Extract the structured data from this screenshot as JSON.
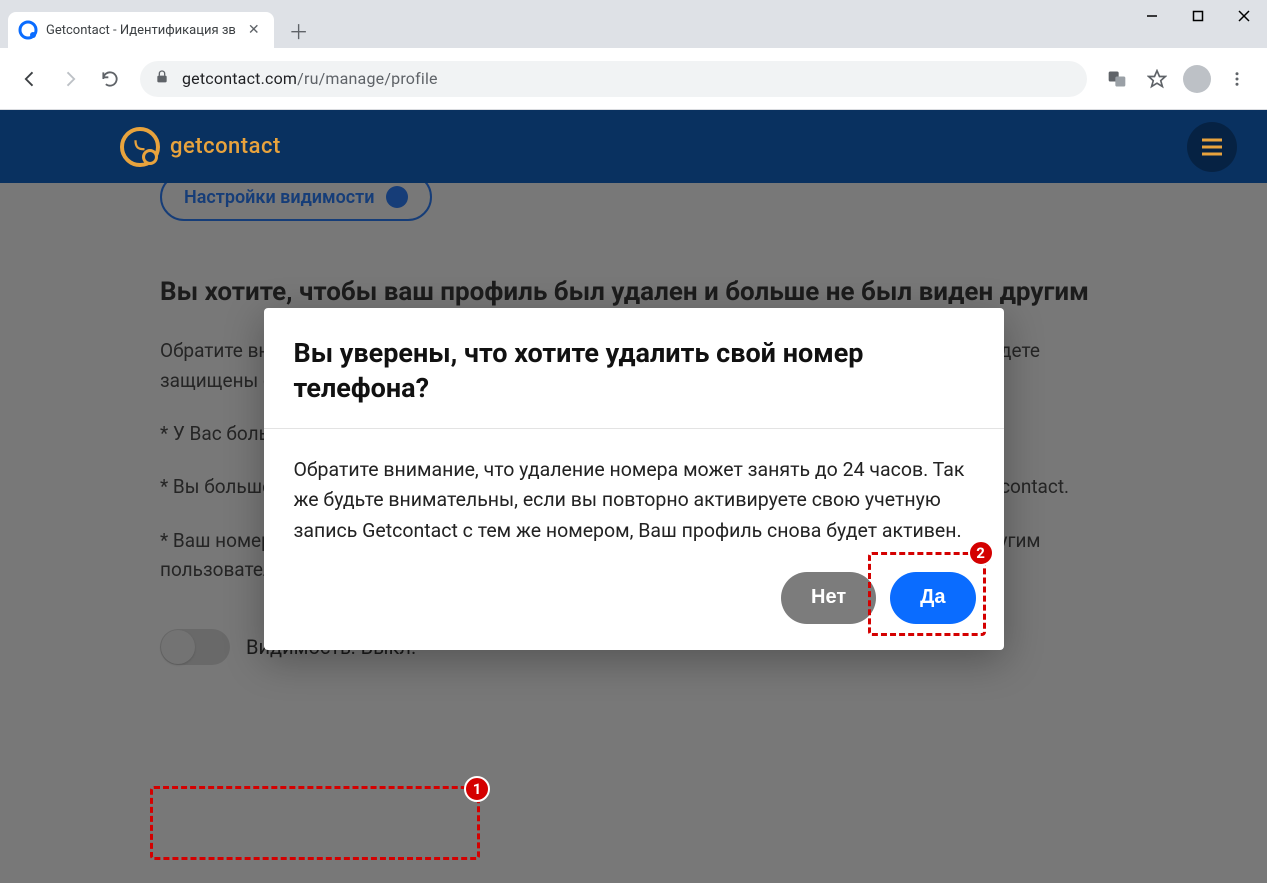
{
  "browser": {
    "tab_title": "Getcontact - Идентификация зв",
    "url_host": "getcontact.com",
    "url_path": "/ru/manage/profile"
  },
  "header": {
    "brand": "getcontact"
  },
  "page": {
    "pill_label": "Настройки видимости",
    "heading": "Вы хотите, чтобы ваш профиль был удален и больше не был виден другим",
    "para1": "Обратите внимание, что после удаления вашего профиля из базы Getcontact вы больше не будете защищены от преследований.",
    "b1": "* У Вас больше не будет доступа к пользованию сервисом.",
    "b2": "* Вы больше не увидите кто звонит при входящем звонке или при добавлении контакта в Getcontact.",
    "b3": "* Ваш номер будет удален из базы Getcontact, и мы не сможем предоставить информации другим пользователям о том, можно ли ему доверять.",
    "toggle_label": "Видимость: Выкл."
  },
  "modal": {
    "title": "Вы уверены, что хотите удалить свой номер телефона?",
    "body": "Обратите внимание, что удаление номера может занять до 24 часов. Так же будьте внимательны, если вы повторно активируете свою учетную запись Getcontact с тем же номером, Ваш профиль снова будет активен.",
    "no": "Нет",
    "yes": "Да"
  },
  "annotations": {
    "m1": "1",
    "m2": "2"
  }
}
